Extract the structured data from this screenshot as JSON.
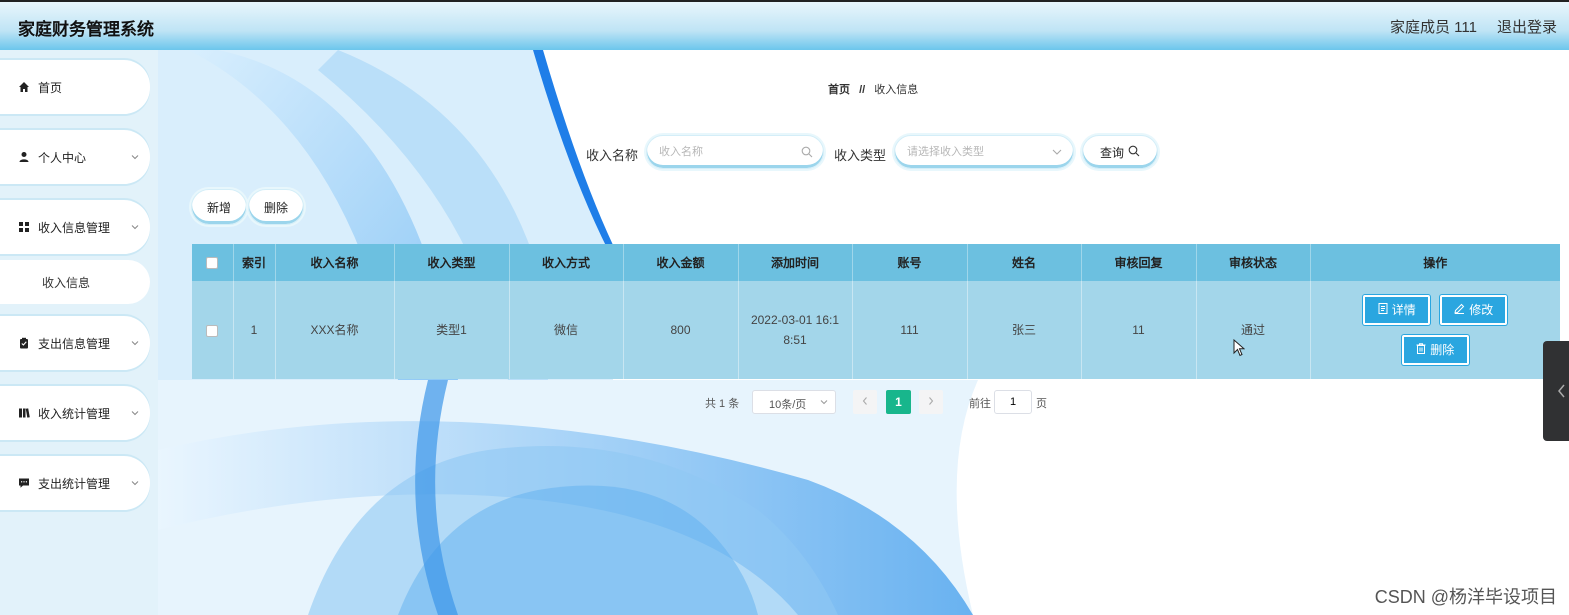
{
  "header": {
    "title": "家庭财务管理系统",
    "user": "家庭成员 111",
    "logout": "退出登录"
  },
  "sidebar": {
    "items": [
      {
        "label": "首页",
        "icon": "home-icon"
      },
      {
        "label": "个人中心",
        "icon": "user-icon"
      },
      {
        "label": "收入信息管理",
        "icon": "grid-icon"
      },
      {
        "label": "支出信息管理",
        "icon": "clipboard-icon"
      },
      {
        "label": "收入统计管理",
        "icon": "book-icon"
      },
      {
        "label": "支出统计管理",
        "icon": "chat-icon"
      }
    ],
    "sub_item": "收入信息"
  },
  "breadcrumb": {
    "home": "首页",
    "sep": "//",
    "current": "收入信息"
  },
  "search": {
    "name_label": "收入名称",
    "name_placeholder": "收入名称",
    "type_label": "收入类型",
    "type_placeholder": "请选择收入类型",
    "query_label": "查询"
  },
  "toolbar": {
    "add_label": "新增",
    "delete_label": "删除"
  },
  "table": {
    "headers": [
      "索引",
      "收入名称",
      "收入类型",
      "收入方式",
      "收入金额",
      "添加时间",
      "账号",
      "姓名",
      "审核回复",
      "审核状态",
      "操作"
    ],
    "rows": [
      {
        "index": "1",
        "name": "XXX名称",
        "type": "类型1",
        "method": "微信",
        "amount": "800",
        "time": "2022-03-01 16:18:51",
        "account": "111",
        "person": "张三",
        "reply": "11",
        "status": "通过"
      }
    ],
    "actions": {
      "detail": "详情",
      "edit": "修改",
      "delete": "删除"
    }
  },
  "pagination": {
    "total": "共 1 条",
    "page_size": "10条/页",
    "current_page": "1",
    "goto_label": "前往",
    "goto_value": "1",
    "page_unit": "页"
  },
  "watermark": "CSDN @杨洋毕设项目",
  "colors": {
    "accent": "#2aa6e0",
    "table_header": "#6cc0e0",
    "table_row": "#a3d6ea",
    "pager_active": "#18b68c"
  }
}
